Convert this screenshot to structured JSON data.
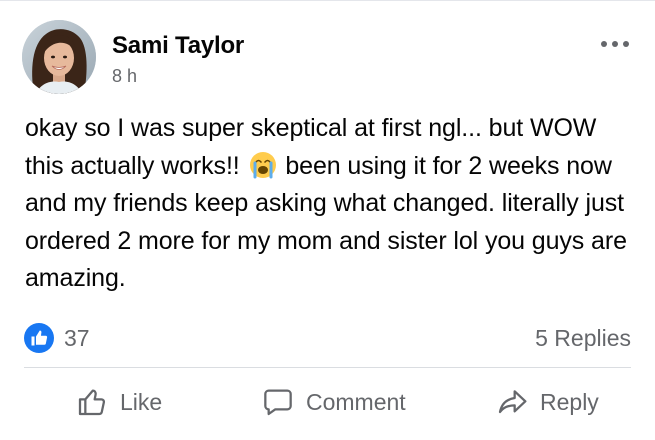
{
  "post": {
    "author": "Sami Taylor",
    "time": "8 h",
    "text_part1": "okay so I  was super skeptical at first ngl... but WOW this actually works!!",
    "text_part2": "been using it for 2 weeks now and my friends keep asking what changed. literally just ordered 2 more for my mom and sister lol you guys are amazing.",
    "emoji": "loudly-crying-face-emoji"
  },
  "stats": {
    "likes": "37",
    "replies": "5 Replies"
  },
  "actions": {
    "like_label": "Like",
    "comment_label": "Comment",
    "reply_label": "Reply"
  },
  "icons": {
    "more": "more-options-icon",
    "like_badge": "thumbs-up-icon",
    "like": "thumbs-up-outline-icon",
    "comment": "speech-bubble-icon",
    "reply": "share-arrow-icon"
  },
  "colors": {
    "accent": "#1877f2",
    "muted_text": "#65676b",
    "text": "#050505",
    "divider": "#dadde1"
  }
}
